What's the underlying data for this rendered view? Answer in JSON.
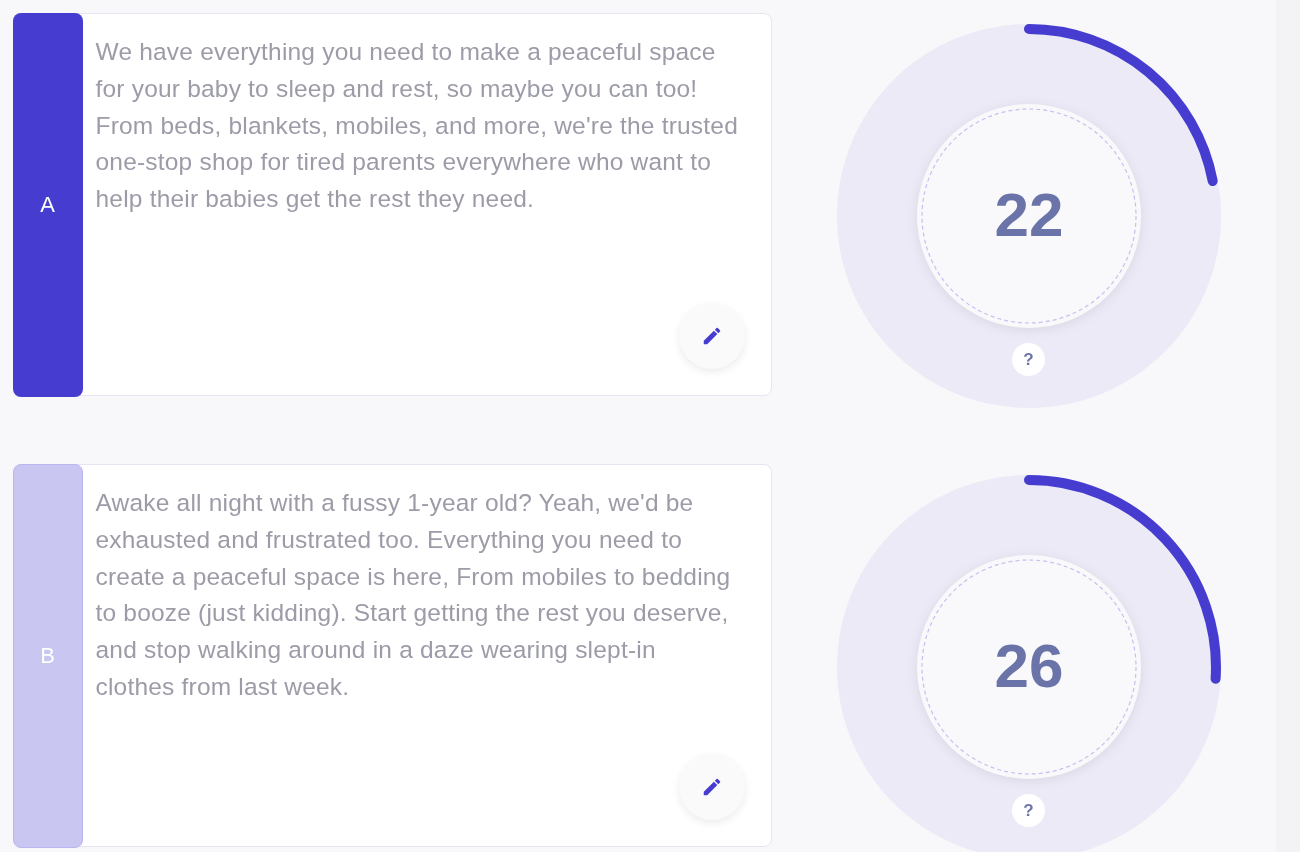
{
  "variants": [
    {
      "label": "A",
      "selected": true,
      "text": "We have everything you need to make a peaceful space for your baby to sleep and rest, so maybe you can too! From beds, blankets, mobiles, and more, we're the trusted one-stop shop for tired parents everywhere who want to help their babies get the rest they need.",
      "score": "22",
      "help": "?"
    },
    {
      "label": "B",
      "selected": false,
      "text": "Awake all night with a fussy 1-year old? Yeah, we'd be exhausted and frustrated too. Everything you need to create a peaceful space is here, From mobiles to bedding to booze (just kidding). Start getting the rest you deserve, and stop walking around in a daze wearing slept-in clothes from last week.",
      "score": "26",
      "help": "?"
    }
  ]
}
